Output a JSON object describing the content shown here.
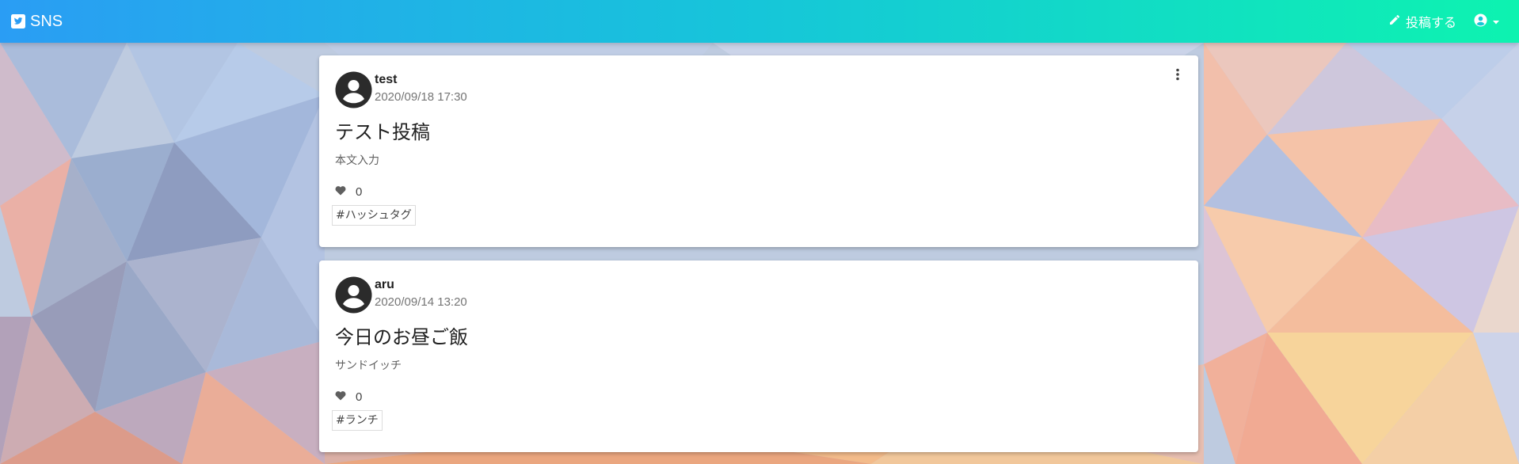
{
  "navbar": {
    "brand_label": "SNS",
    "post_label": "投稿する",
    "brand_icon": "twitter-square-icon",
    "post_icon": "pencil-icon",
    "account_icon": "user-circle-icon",
    "gradient_colors": [
      "#2a9df4",
      "#16c6d9",
      "#0df3b0"
    ]
  },
  "posts": [
    {
      "username": "test",
      "timestamp": "2020/09/18 17:30",
      "title": "テスト投稿",
      "body": "本文入力",
      "likes": "0",
      "tags": [
        "#ハッシュタグ"
      ],
      "has_menu": true
    },
    {
      "username": "aru",
      "timestamp": "2020/09/14 13:20",
      "title": "今日のお昼ご飯",
      "body": "サンドイッチ",
      "likes": "0",
      "tags": [
        "#ランチ"
      ],
      "has_menu": false
    }
  ]
}
